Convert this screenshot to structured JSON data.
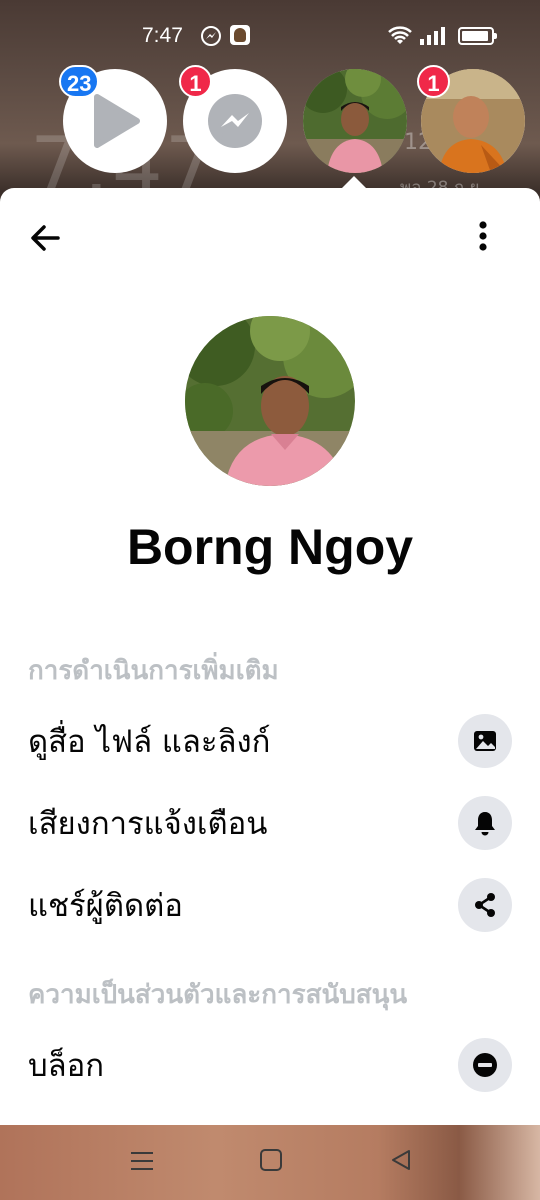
{
  "status_bar": {
    "time": "7:47"
  },
  "wallpaper": {
    "clock": "7:47",
    "date_line1": "12",
    "date_line2": "พอ 28 ก.ย."
  },
  "chat_heads": [
    {
      "name": "play-head",
      "badge": "23",
      "badge_color": "#1877f2"
    },
    {
      "name": "messenger-head",
      "badge": "1",
      "badge_color": "#f02849"
    },
    {
      "name": "contact-head-borng",
      "badge": ""
    },
    {
      "name": "contact-head-monk",
      "badge": "1",
      "badge_color": "#f02849"
    }
  ],
  "profile": {
    "name": "Borng Ngoy"
  },
  "sections": {
    "more_actions": "การดำเนินการเพิ่มเติม",
    "privacy_support": "ความเป็นส่วนตัวและการสนับสนุน"
  },
  "actions": {
    "view_media": "ดูสื่อ ไฟล์ และลิงก์",
    "notification_sounds": "เสียงการแจ้งเตือน",
    "share_contact": "แชร์ผู้ติดต่อ",
    "block": "บล็อก"
  },
  "colors": {
    "accent_blue": "#1877f2",
    "badge_red": "#f02849",
    "icon_circle": "#e4e6eb",
    "section_gray": "#bcc0c4"
  }
}
